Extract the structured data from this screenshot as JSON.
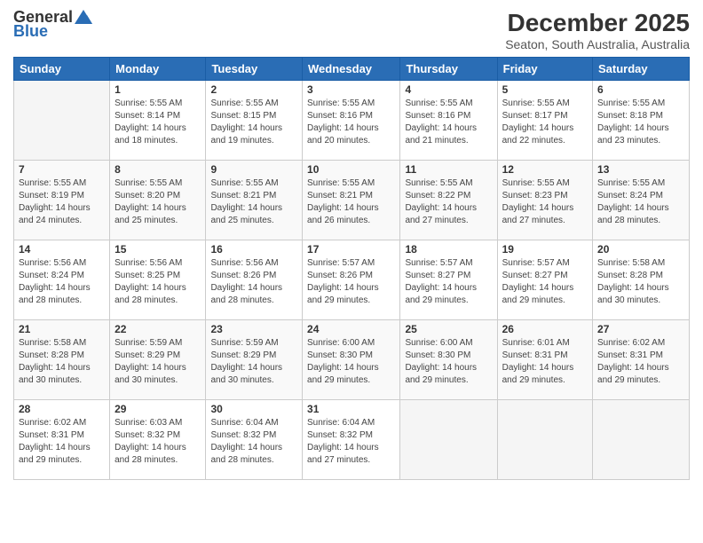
{
  "header": {
    "logo_general": "General",
    "logo_blue": "Blue",
    "month_title": "December 2025",
    "location": "Seaton, South Australia, Australia"
  },
  "days_of_week": [
    "Sunday",
    "Monday",
    "Tuesday",
    "Wednesday",
    "Thursday",
    "Friday",
    "Saturday"
  ],
  "weeks": [
    [
      {
        "day": "",
        "sunrise": "",
        "sunset": "",
        "daylight": ""
      },
      {
        "day": "1",
        "sunrise": "Sunrise: 5:55 AM",
        "sunset": "Sunset: 8:14 PM",
        "daylight": "Daylight: 14 hours and 18 minutes."
      },
      {
        "day": "2",
        "sunrise": "Sunrise: 5:55 AM",
        "sunset": "Sunset: 8:15 PM",
        "daylight": "Daylight: 14 hours and 19 minutes."
      },
      {
        "day": "3",
        "sunrise": "Sunrise: 5:55 AM",
        "sunset": "Sunset: 8:16 PM",
        "daylight": "Daylight: 14 hours and 20 minutes."
      },
      {
        "day": "4",
        "sunrise": "Sunrise: 5:55 AM",
        "sunset": "Sunset: 8:16 PM",
        "daylight": "Daylight: 14 hours and 21 minutes."
      },
      {
        "day": "5",
        "sunrise": "Sunrise: 5:55 AM",
        "sunset": "Sunset: 8:17 PM",
        "daylight": "Daylight: 14 hours and 22 minutes."
      },
      {
        "day": "6",
        "sunrise": "Sunrise: 5:55 AM",
        "sunset": "Sunset: 8:18 PM",
        "daylight": "Daylight: 14 hours and 23 minutes."
      }
    ],
    [
      {
        "day": "7",
        "sunrise": "Sunrise: 5:55 AM",
        "sunset": "Sunset: 8:19 PM",
        "daylight": "Daylight: 14 hours and 24 minutes."
      },
      {
        "day": "8",
        "sunrise": "Sunrise: 5:55 AM",
        "sunset": "Sunset: 8:20 PM",
        "daylight": "Daylight: 14 hours and 25 minutes."
      },
      {
        "day": "9",
        "sunrise": "Sunrise: 5:55 AM",
        "sunset": "Sunset: 8:21 PM",
        "daylight": "Daylight: 14 hours and 25 minutes."
      },
      {
        "day": "10",
        "sunrise": "Sunrise: 5:55 AM",
        "sunset": "Sunset: 8:21 PM",
        "daylight": "Daylight: 14 hours and 26 minutes."
      },
      {
        "day": "11",
        "sunrise": "Sunrise: 5:55 AM",
        "sunset": "Sunset: 8:22 PM",
        "daylight": "Daylight: 14 hours and 27 minutes."
      },
      {
        "day": "12",
        "sunrise": "Sunrise: 5:55 AM",
        "sunset": "Sunset: 8:23 PM",
        "daylight": "Daylight: 14 hours and 27 minutes."
      },
      {
        "day": "13",
        "sunrise": "Sunrise: 5:55 AM",
        "sunset": "Sunset: 8:24 PM",
        "daylight": "Daylight: 14 hours and 28 minutes."
      }
    ],
    [
      {
        "day": "14",
        "sunrise": "Sunrise: 5:56 AM",
        "sunset": "Sunset: 8:24 PM",
        "daylight": "Daylight: 14 hours and 28 minutes."
      },
      {
        "day": "15",
        "sunrise": "Sunrise: 5:56 AM",
        "sunset": "Sunset: 8:25 PM",
        "daylight": "Daylight: 14 hours and 28 minutes."
      },
      {
        "day": "16",
        "sunrise": "Sunrise: 5:56 AM",
        "sunset": "Sunset: 8:26 PM",
        "daylight": "Daylight: 14 hours and 28 minutes."
      },
      {
        "day": "17",
        "sunrise": "Sunrise: 5:57 AM",
        "sunset": "Sunset: 8:26 PM",
        "daylight": "Daylight: 14 hours and 29 minutes."
      },
      {
        "day": "18",
        "sunrise": "Sunrise: 5:57 AM",
        "sunset": "Sunset: 8:27 PM",
        "daylight": "Daylight: 14 hours and 29 minutes."
      },
      {
        "day": "19",
        "sunrise": "Sunrise: 5:57 AM",
        "sunset": "Sunset: 8:27 PM",
        "daylight": "Daylight: 14 hours and 29 minutes."
      },
      {
        "day": "20",
        "sunrise": "Sunrise: 5:58 AM",
        "sunset": "Sunset: 8:28 PM",
        "daylight": "Daylight: 14 hours and 30 minutes."
      }
    ],
    [
      {
        "day": "21",
        "sunrise": "Sunrise: 5:58 AM",
        "sunset": "Sunset: 8:28 PM",
        "daylight": "Daylight: 14 hours and 30 minutes."
      },
      {
        "day": "22",
        "sunrise": "Sunrise: 5:59 AM",
        "sunset": "Sunset: 8:29 PM",
        "daylight": "Daylight: 14 hours and 30 minutes."
      },
      {
        "day": "23",
        "sunrise": "Sunrise: 5:59 AM",
        "sunset": "Sunset: 8:29 PM",
        "daylight": "Daylight: 14 hours and 30 minutes."
      },
      {
        "day": "24",
        "sunrise": "Sunrise: 6:00 AM",
        "sunset": "Sunset: 8:30 PM",
        "daylight": "Daylight: 14 hours and 29 minutes."
      },
      {
        "day": "25",
        "sunrise": "Sunrise: 6:00 AM",
        "sunset": "Sunset: 8:30 PM",
        "daylight": "Daylight: 14 hours and 29 minutes."
      },
      {
        "day": "26",
        "sunrise": "Sunrise: 6:01 AM",
        "sunset": "Sunset: 8:31 PM",
        "daylight": "Daylight: 14 hours and 29 minutes."
      },
      {
        "day": "27",
        "sunrise": "Sunrise: 6:02 AM",
        "sunset": "Sunset: 8:31 PM",
        "daylight": "Daylight: 14 hours and 29 minutes."
      }
    ],
    [
      {
        "day": "28",
        "sunrise": "Sunrise: 6:02 AM",
        "sunset": "Sunset: 8:31 PM",
        "daylight": "Daylight: 14 hours and 29 minutes."
      },
      {
        "day": "29",
        "sunrise": "Sunrise: 6:03 AM",
        "sunset": "Sunset: 8:32 PM",
        "daylight": "Daylight: 14 hours and 28 minutes."
      },
      {
        "day": "30",
        "sunrise": "Sunrise: 6:04 AM",
        "sunset": "Sunset: 8:32 PM",
        "daylight": "Daylight: 14 hours and 28 minutes."
      },
      {
        "day": "31",
        "sunrise": "Sunrise: 6:04 AM",
        "sunset": "Sunset: 8:32 PM",
        "daylight": "Daylight: 14 hours and 27 minutes."
      },
      {
        "day": "",
        "sunrise": "",
        "sunset": "",
        "daylight": ""
      },
      {
        "day": "",
        "sunrise": "",
        "sunset": "",
        "daylight": ""
      },
      {
        "day": "",
        "sunrise": "",
        "sunset": "",
        "daylight": ""
      }
    ]
  ]
}
